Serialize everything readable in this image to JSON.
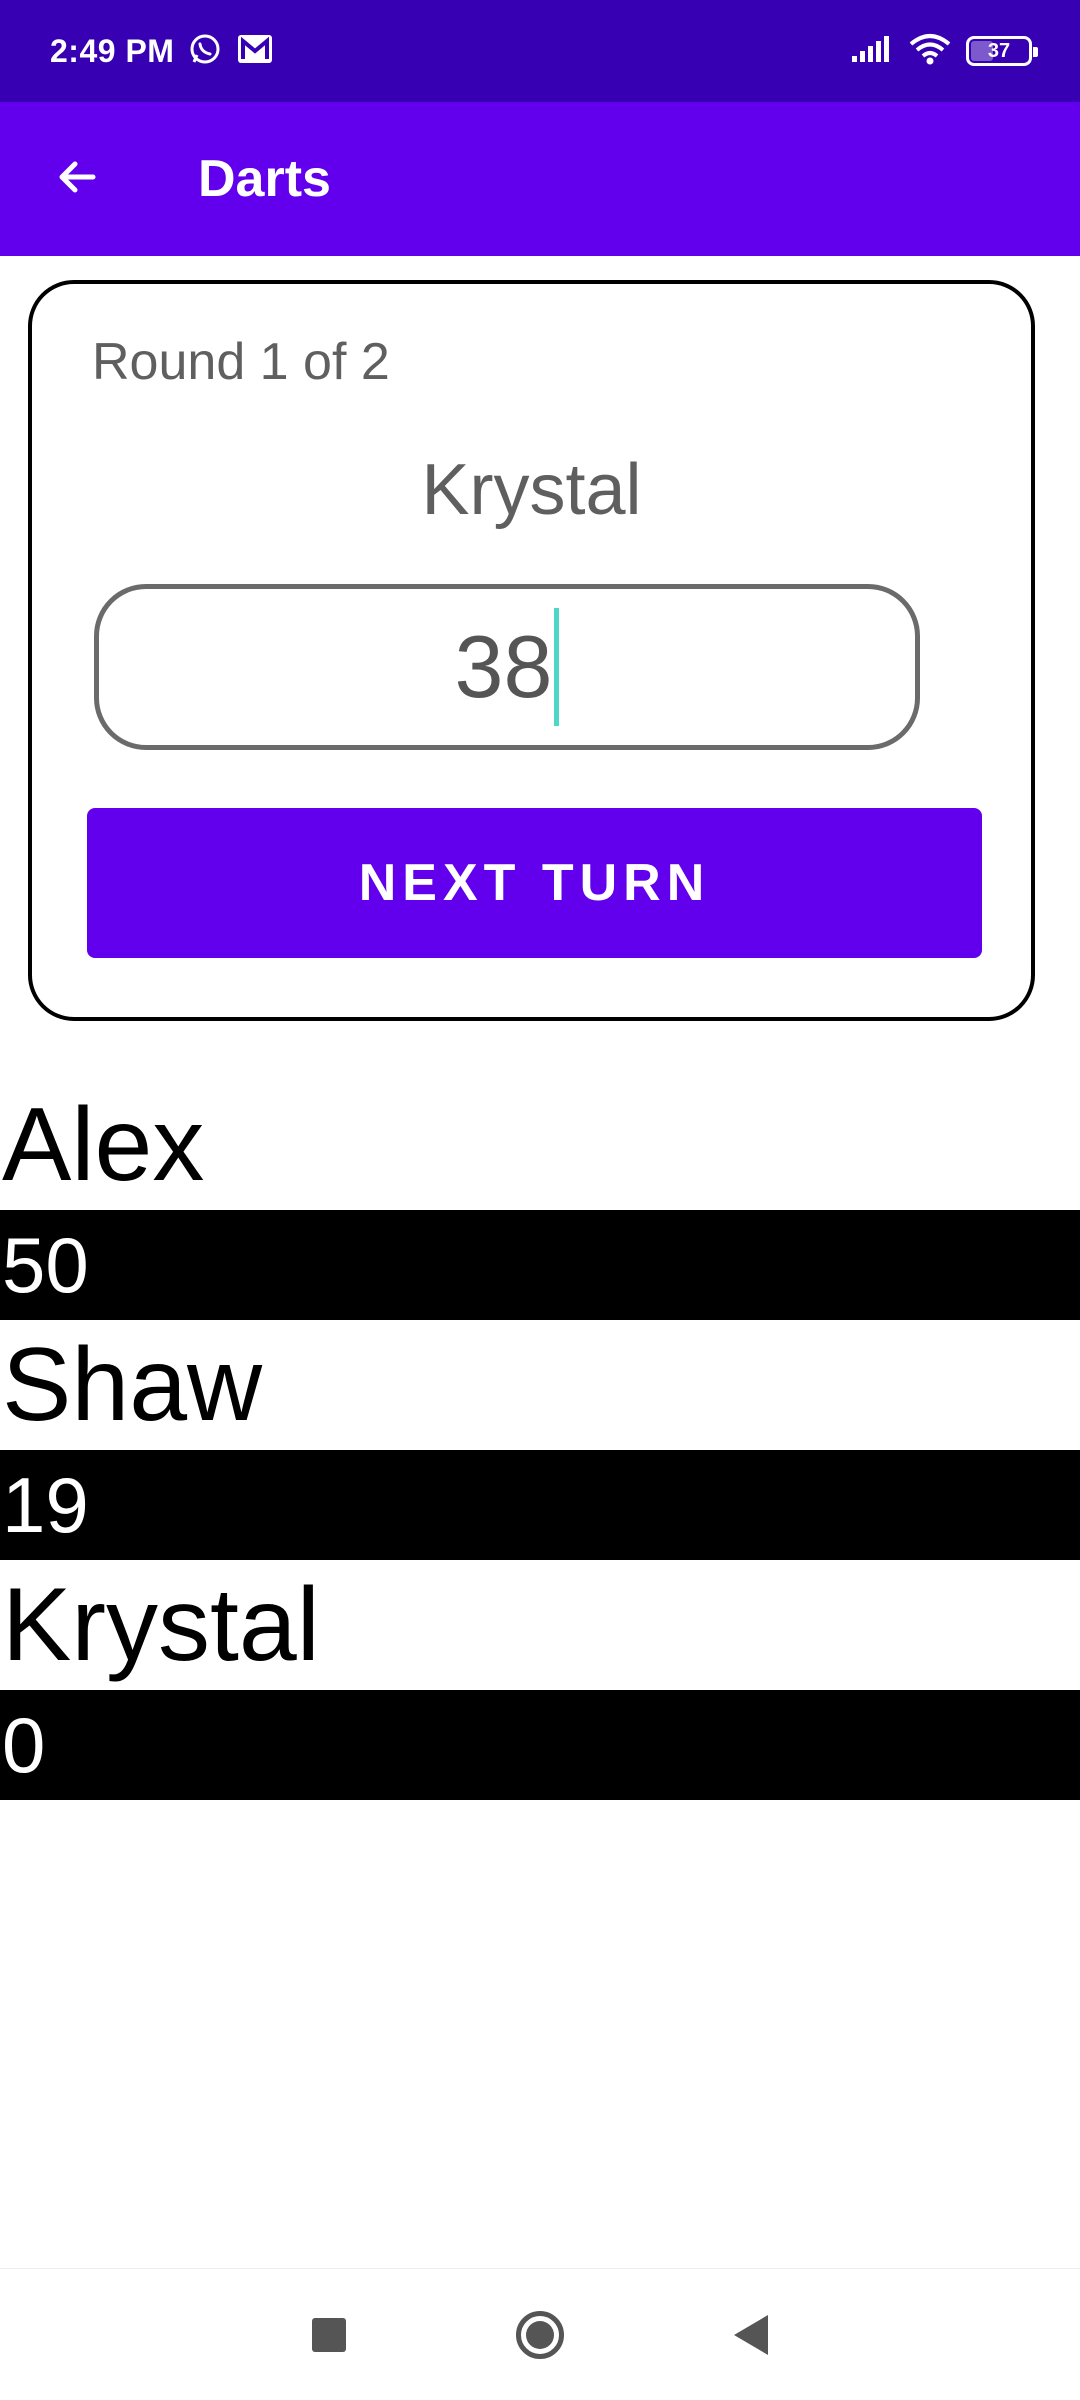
{
  "status_bar": {
    "time": "2:49 PM",
    "notification_icons": [
      "whatsapp-icon",
      "gmail-icon"
    ],
    "battery_level": "37"
  },
  "app_bar": {
    "title": "Darts",
    "back_icon": "arrow-left-icon"
  },
  "turn_card": {
    "round_label": "Round 1 of 2",
    "current_player": "Krystal",
    "score_input_value": "38",
    "next_button_label": "NEXT TURN"
  },
  "players": [
    {
      "name": "Alex",
      "score": "50"
    },
    {
      "name": "Shaw",
      "score": "19"
    },
    {
      "name": "Krystal",
      "score": "0"
    }
  ],
  "colors": {
    "status_bar": "#3700b3",
    "primary": "#6200ee",
    "caret": "#4ed6c6",
    "score_bar": "#000000"
  },
  "nav_bar": {
    "icons": [
      "recents-icon",
      "home-icon",
      "back-icon"
    ]
  }
}
